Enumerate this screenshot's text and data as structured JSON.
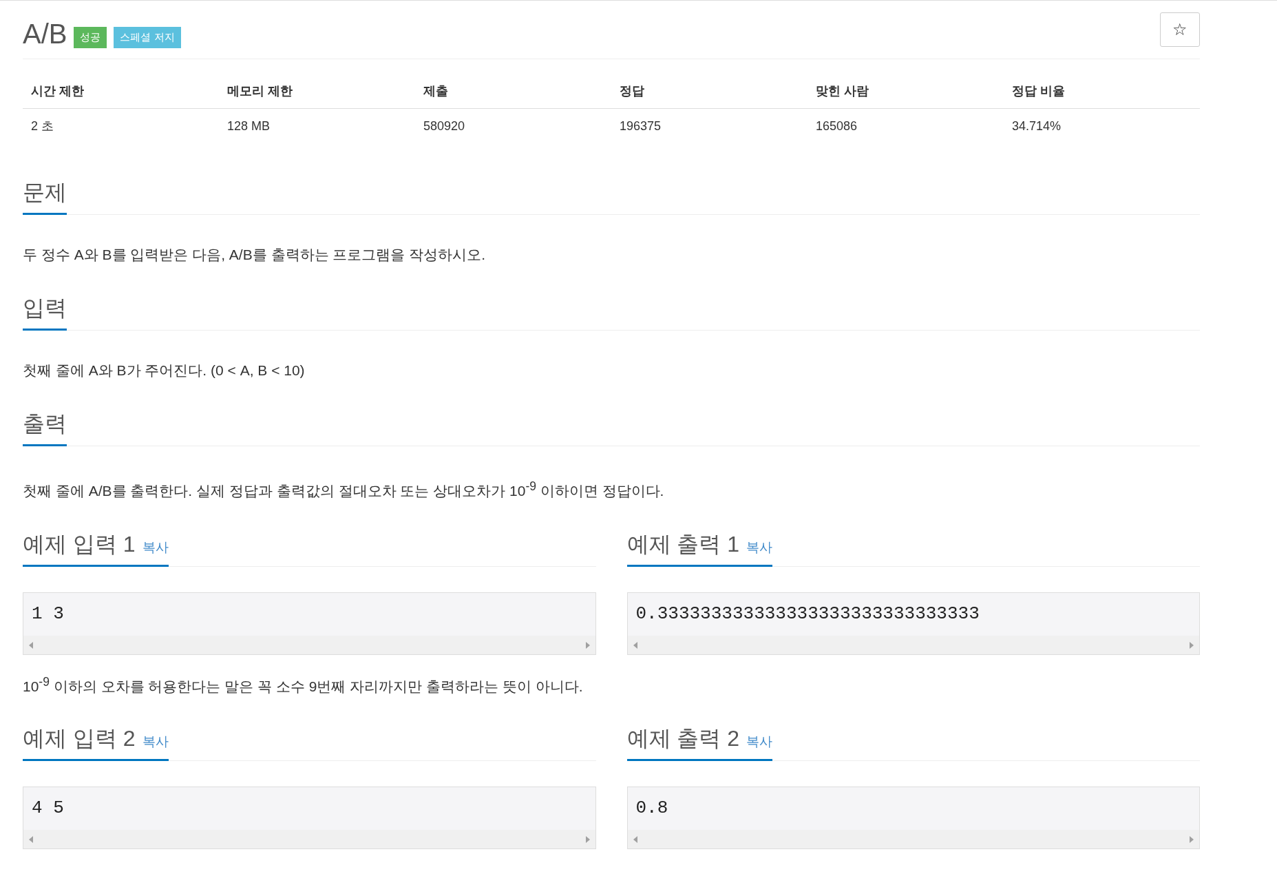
{
  "title": "A/B",
  "badges": [
    {
      "label": "성공",
      "color": "#5cb85c"
    },
    {
      "label": "스페셜 저지",
      "color": "#5bc0de"
    }
  ],
  "star_button": {
    "label": "☆"
  },
  "stats": {
    "columns": [
      "시간 제한",
      "메모리 제한",
      "제출",
      "정답",
      "맞힌 사람",
      "정답 비율"
    ],
    "row": [
      "2 초",
      "128 MB",
      "580920",
      "196375",
      "165086",
      "34.714%"
    ]
  },
  "sections": [
    {
      "heading": "문제",
      "body": "두 정수 A와 B를 입력받은 다음, A/B를 출력하는 프로그램을 작성하시오."
    },
    {
      "heading": "입력",
      "body": "첫째 줄에 A와 B가 주어진다. (0 < A, B < 10)"
    },
    {
      "heading": "출력",
      "body": "첫째 줄에 A/B를 출력한다. 실제 정답과 출력값의 절대오차 또는 상대오차가 10$^{-9}$ 이하이면 정답이다."
    }
  ],
  "sample_groups": [
    {
      "input": {
        "heading": "예제 입력 1",
        "copy": "복사",
        "value": "1 3"
      },
      "output": {
        "heading": "예제 출력 1",
        "copy": "복사",
        "value": "0.333333333333333333333333333333"
      },
      "note": "10$^{-9}$ 이하의 오차를 허용한다는 말은 꼭 소수 9번째 자리까지만 출력하라는 뜻이 아니다."
    },
    {
      "input": {
        "heading": "예제 입력 2",
        "copy": "복사",
        "value": "4 5"
      },
      "output": {
        "heading": "예제 출력 2",
        "copy": "복사",
        "value": "0.8"
      }
    }
  ]
}
